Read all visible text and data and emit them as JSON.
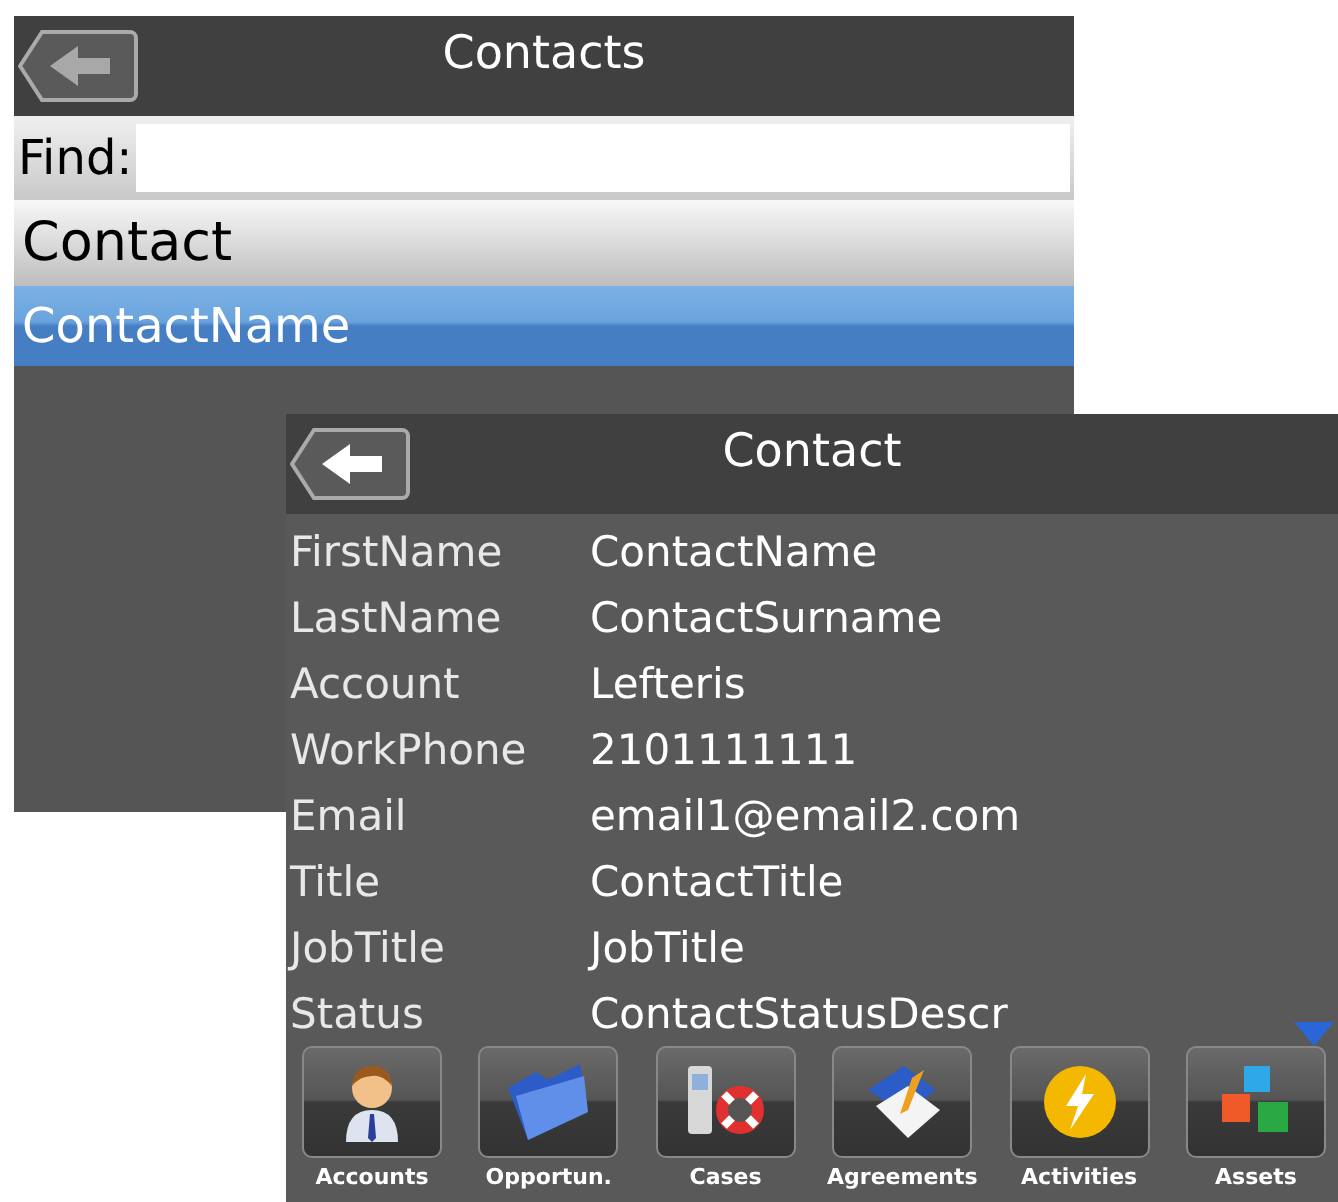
{
  "contacts_screen": {
    "title": "Contacts",
    "find_label": "Find:",
    "column_header": "Contact",
    "rows": [
      {
        "name": "ContactName",
        "selected": true
      }
    ]
  },
  "contact_screen": {
    "title": "Contact",
    "fields": [
      {
        "label": "FirstName",
        "value": "ContactName"
      },
      {
        "label": "LastName",
        "value": "ContactSurname"
      },
      {
        "label": "Account",
        "value": "Lefteris"
      },
      {
        "label": "WorkPhone",
        "value": "2101111111"
      },
      {
        "label": "Email",
        "value": "email1@email2.com"
      },
      {
        "label": "Title",
        "value": "ContactTitle"
      },
      {
        "label": "JobTitle",
        "value": "JobTitle"
      },
      {
        "label": "Status",
        "value": "ContactStatusDescr"
      }
    ],
    "toolbar": [
      {
        "label": "Accounts"
      },
      {
        "label": "Opportun."
      },
      {
        "label": "Cases"
      },
      {
        "label": "Agreements"
      },
      {
        "label": "Activities"
      },
      {
        "label": "Assets"
      }
    ]
  }
}
